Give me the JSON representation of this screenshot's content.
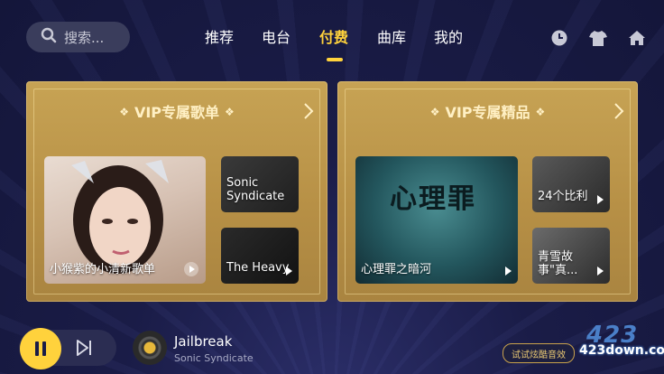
{
  "search": {
    "placeholder": "搜索..."
  },
  "nav": {
    "tabs": [
      {
        "label": "推荐"
      },
      {
        "label": "电台"
      },
      {
        "label": "付费",
        "active": true
      },
      {
        "label": "曲库"
      },
      {
        "label": "我的"
      }
    ],
    "icons": [
      "history-icon",
      "skin-icon",
      "home-icon"
    ]
  },
  "vip_playlists": {
    "title": "VIP专属歌单",
    "main": {
      "caption": "小猴紫的小清新歌单"
    },
    "side": [
      {
        "caption": "Sonic Syndicate"
      },
      {
        "caption": "The Heavy"
      }
    ]
  },
  "vip_premium": {
    "title": "VIP专属精品",
    "main": {
      "caption": "心理罪之暗河",
      "poster_text": "心理罪"
    },
    "side": [
      {
        "caption": "24个比利"
      },
      {
        "caption": "青雪故事\"真..."
      }
    ]
  },
  "player": {
    "song": "Jailbreak",
    "artist": "Sonic Syndicate",
    "sfx_label": "试试炫酷音效"
  },
  "watermark": {
    "big": "423",
    "small": "423down.com"
  },
  "colors": {
    "accent": "#ffd23c",
    "card_gold": "#c7a354",
    "bg": "#1a1c47"
  }
}
